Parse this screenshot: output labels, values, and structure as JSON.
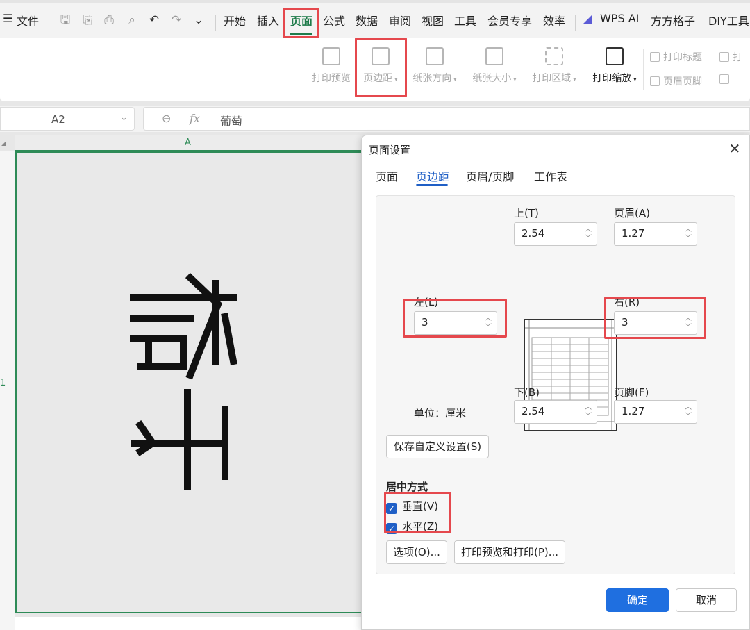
{
  "menubar": {
    "file_label": "文件",
    "tabs": [
      "开始",
      "插入",
      "页面",
      "公式",
      "数据",
      "审阅",
      "视图",
      "工具",
      "会员专享",
      "效率",
      "WPS AI",
      "方方格子",
      "DIY工具"
    ],
    "active_tab": "页面"
  },
  "ribbon": {
    "print_preview": "打印预览",
    "margins": "页边距",
    "orientation": "纸张方向",
    "paper_size": "纸张大小",
    "print_area": "打印区域",
    "print_scale": "打印缩放",
    "print_titles": "打印标题",
    "header_footer": "页眉页脚",
    "print_check": "打"
  },
  "formula_bar": {
    "name_box": "A2",
    "fx": "fx",
    "content": "葡萄"
  },
  "sheet": {
    "col_a": "A",
    "row_1": "1"
  },
  "dialog": {
    "title": "页面设置",
    "tabs": [
      "页面",
      "页边距",
      "页眉/页脚",
      "工作表"
    ],
    "active_tab": "页边距",
    "top_label": "上(T)",
    "top_value": "2.54",
    "header_label": "页眉(A)",
    "header_value": "1.27",
    "left_label": "左(L)",
    "left_value": "3",
    "right_label": "右(R)",
    "right_value": "3",
    "bottom_label": "下(B)",
    "bottom_value": "2.54",
    "footer_label": "页脚(F)",
    "footer_value": "1.27",
    "unit_label": "单位：厘米",
    "save_custom": "保存自定义设置(S)",
    "center_title": "居中方式",
    "vertical": "垂直(V)",
    "horizontal": "水平(Z)",
    "options": "选项(O)...",
    "print_preview_print": "打印预览和打印(P)...",
    "ok": "确定",
    "cancel": "取消"
  },
  "colors": {
    "accent": "#1f5fc6",
    "active_green": "#1e7b4a",
    "highlight_red": "#e5484d",
    "selection_green": "#2e8b57"
  }
}
